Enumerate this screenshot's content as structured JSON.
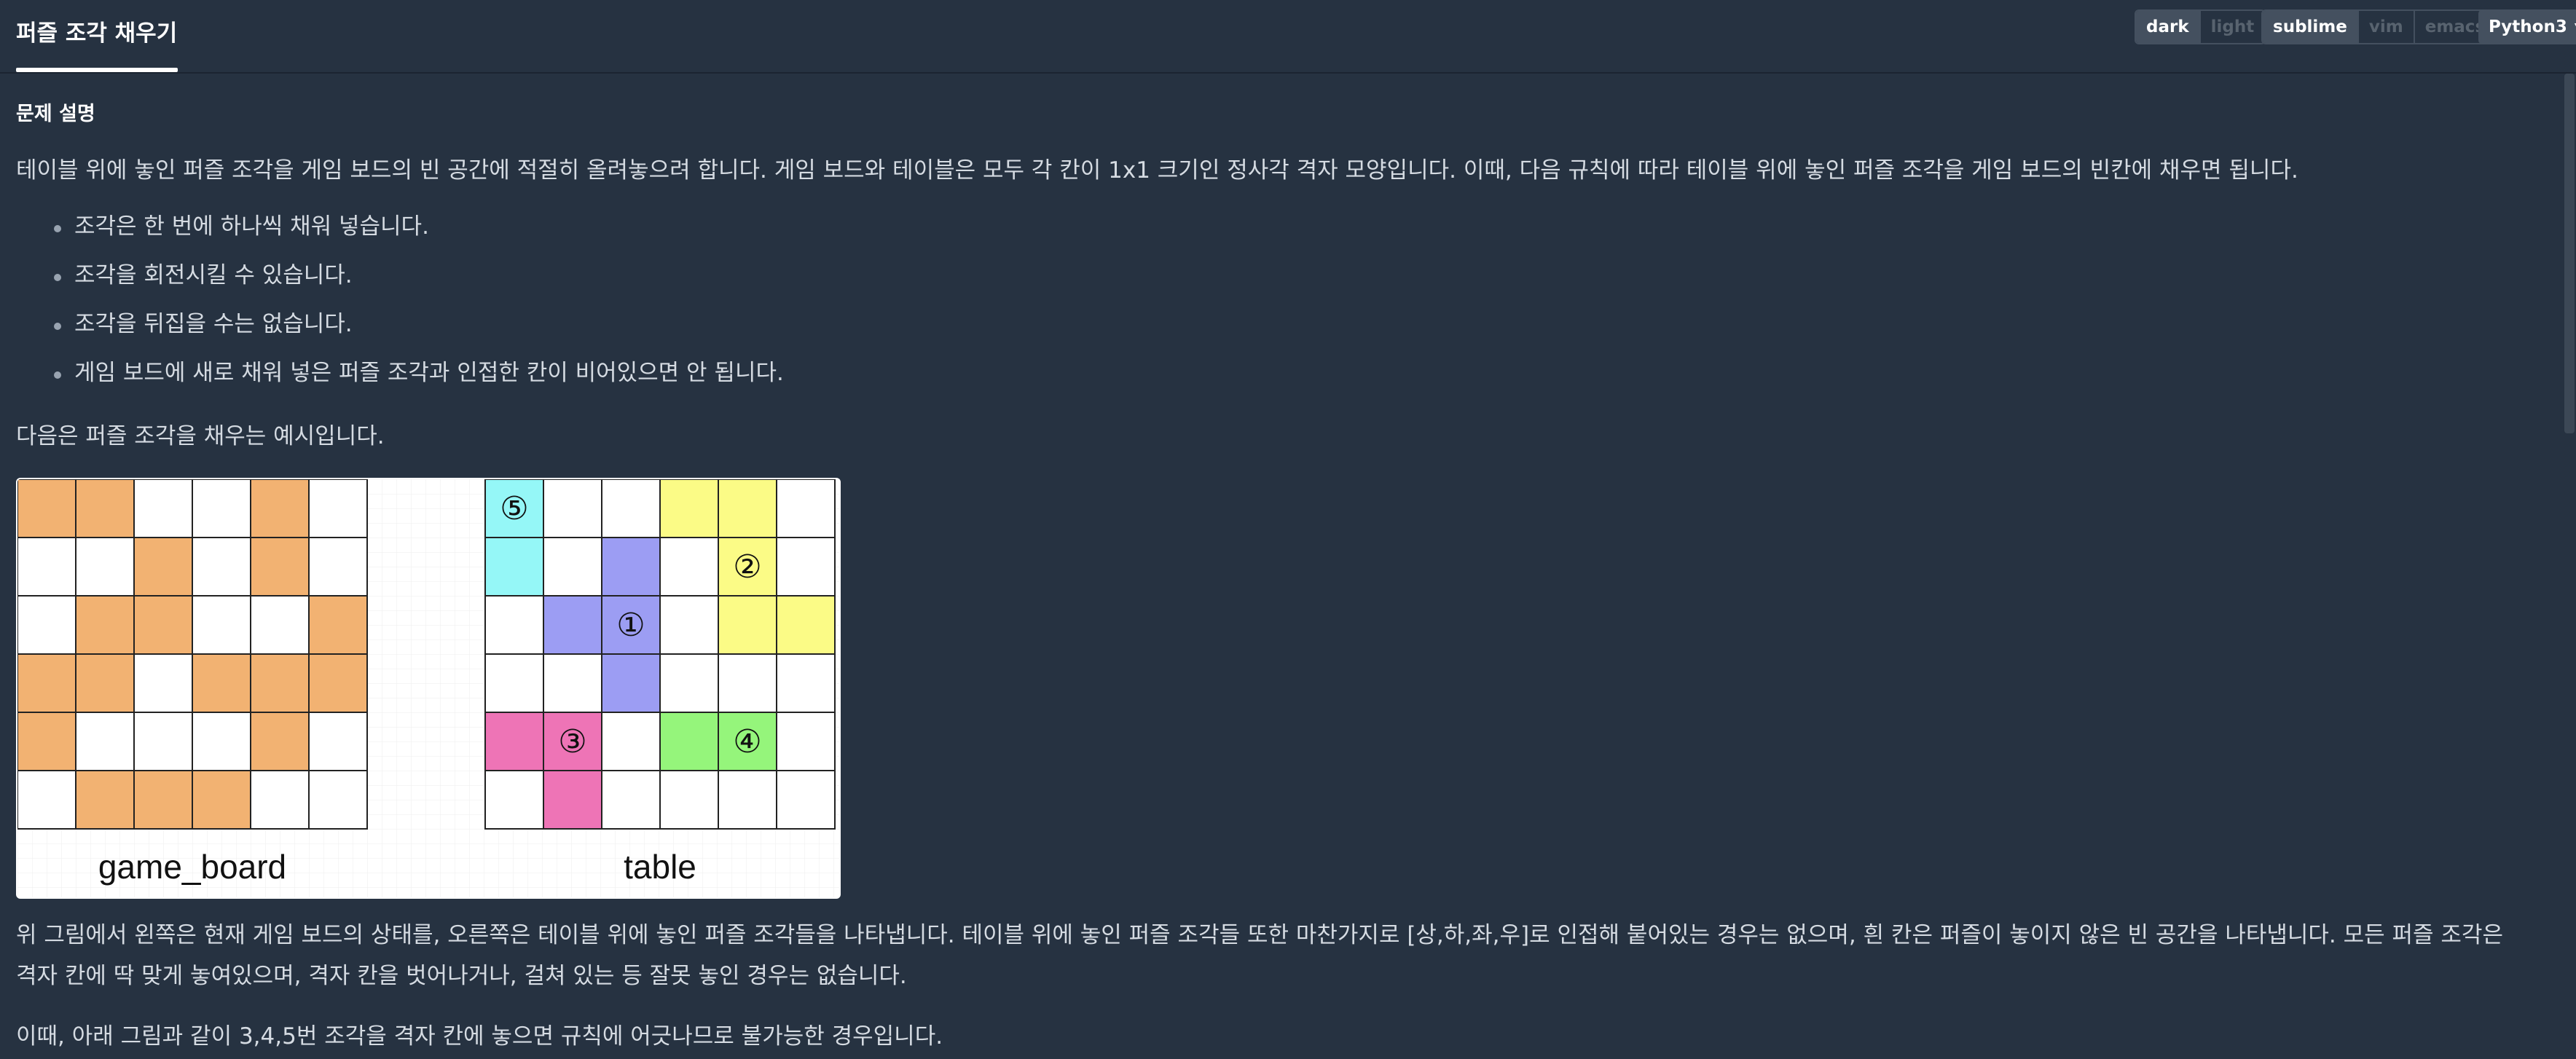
{
  "header": {
    "title": "퍼즐 조각 채우기",
    "theme_options": [
      "dark",
      "light"
    ],
    "theme_selected": "dark",
    "keymap_options": [
      "sublime",
      "vim",
      "emacs"
    ],
    "keymap_selected": "sublime",
    "language": "Python3"
  },
  "problem": {
    "section_title": "문제 설명",
    "intro": "테이블 위에 놓인 퍼즐 조각을 게임 보드의 빈 공간에 적절히 올려놓으려 합니다. 게임 보드와 테이블은 모두 각 칸이 1x1 크기인 정사각 격자 모양입니다. 이때, 다음 규칙에 따라 테이블 위에 놓인 퍼즐 조각을 게임 보드의 빈칸에 채우면 됩니다.",
    "rules": [
      "조각은 한 번에 하나씩 채워 넣습니다.",
      "조각을 회전시킬 수 있습니다.",
      "조각을 뒤집을 수는 없습니다.",
      "게임 보드에 새로 채워 넣은 퍼즐 조각과 인접한 칸이 비어있으면 안 됩니다."
    ],
    "example_intro": "다음은 퍼즐 조각을 채우는 예시입니다.",
    "explanation_line1": "위 그림에서 왼쪽은 현재 게임 보드의 상태를, 오른쪽은 테이블 위에 놓인 퍼즐 조각들을 나타냅니다. 테이블 위에 놓인 퍼즐 조각들 또한 마찬가지로 [상,하,좌,우]로 인접해 붙어있는 경우는 없으며, 흰 칸은 퍼즐이 놓이지 않은 빈 공간을 나타냅니다. 모든 퍼즐 조각은",
    "explanation_line2": "격자 칸에 딱 맞게 놓여있으며, 격자 칸을 벗어나거나, 걸쳐 있는 등 잘못 놓인 경우는 없습니다.",
    "next_line": "이때, 아래 그림과 같이 3,4,5번 조각을 격자 칸에 놓으면 규칙에 어긋나므로 불가능한 경우입니다."
  },
  "figure": {
    "game_board_label": "game_board",
    "table_label": "table",
    "colors": {
      "orange": "#f2b272",
      "cyan": "#95f7f7",
      "blue": "#9c9df3",
      "yellow": "#fbfb86",
      "pink": "#ee74b6",
      "green": "#95f57b",
      "white": "#ffffff"
    },
    "game_board": [
      [
        "orange",
        "orange",
        "white",
        "white",
        "orange",
        "white"
      ],
      [
        "white",
        "white",
        "orange",
        "white",
        "orange",
        "white"
      ],
      [
        "white",
        "orange",
        "orange",
        "white",
        "white",
        "orange"
      ],
      [
        "orange",
        "orange",
        "white",
        "orange",
        "orange",
        "orange"
      ],
      [
        "orange",
        "white",
        "white",
        "white",
        "orange",
        "white"
      ],
      [
        "white",
        "orange",
        "orange",
        "orange",
        "white",
        "white"
      ]
    ],
    "table": [
      [
        "cyan",
        "white",
        "white",
        "yellow",
        "yellow",
        "white"
      ],
      [
        "cyan",
        "white",
        "blue",
        "white",
        "yellow",
        "white"
      ],
      [
        "white",
        "blue",
        "blue",
        "white",
        "yellow",
        "yellow"
      ],
      [
        "white",
        "white",
        "blue",
        "white",
        "white",
        "white"
      ],
      [
        "pink",
        "pink",
        "white",
        "green",
        "green",
        "white"
      ],
      [
        "white",
        "pink",
        "white",
        "white",
        "white",
        "white"
      ]
    ],
    "piece_labels": [
      {
        "text": "⑤",
        "row": 0,
        "col": 0
      },
      {
        "text": "②",
        "row": 1,
        "col": 4
      },
      {
        "text": "①",
        "row": 2,
        "col": 2
      },
      {
        "text": "③",
        "row": 4,
        "col": 1
      },
      {
        "text": "④",
        "row": 4,
        "col": 4
      }
    ]
  }
}
